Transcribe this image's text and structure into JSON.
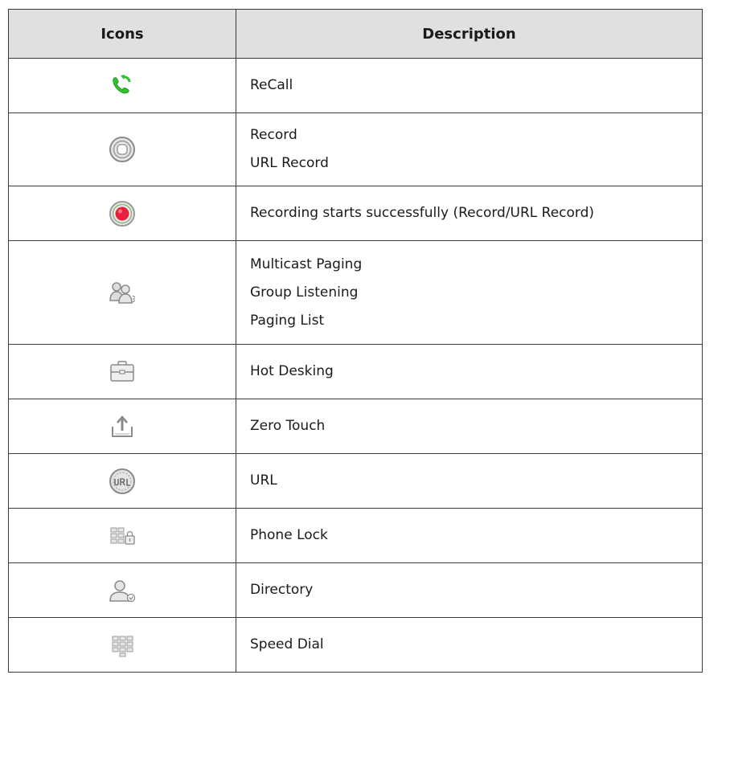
{
  "table": {
    "headers": {
      "icons": "Icons",
      "description": "Description"
    },
    "rows": [
      {
        "icon": "recall-phone-icon",
        "lines": [
          "ReCall"
        ]
      },
      {
        "icon": "record-icon",
        "lines": [
          "Record",
          "URL Record"
        ]
      },
      {
        "icon": "recording-active-icon",
        "lines": [
          "Recording starts successfully (Record/URL Record)"
        ]
      },
      {
        "icon": "multicast-paging-icon",
        "lines": [
          "Multicast Paging",
          "Group Listening",
          "Paging List"
        ]
      },
      {
        "icon": "hot-desking-icon",
        "lines": [
          "Hot Desking"
        ]
      },
      {
        "icon": "zero-touch-icon",
        "lines": [
          "Zero Touch"
        ]
      },
      {
        "icon": "url-icon",
        "lines": [
          "URL"
        ]
      },
      {
        "icon": "phone-lock-icon",
        "lines": [
          "Phone Lock"
        ]
      },
      {
        "icon": "directory-icon",
        "lines": [
          "Directory"
        ]
      },
      {
        "icon": "speed-dial-icon",
        "lines": [
          "Speed Dial"
        ]
      }
    ],
    "colors": {
      "header_bg": "#e0e0e0",
      "border": "#3a3a3a",
      "recall_green": "#2fbf2f",
      "record_red": "#e8203c"
    }
  }
}
